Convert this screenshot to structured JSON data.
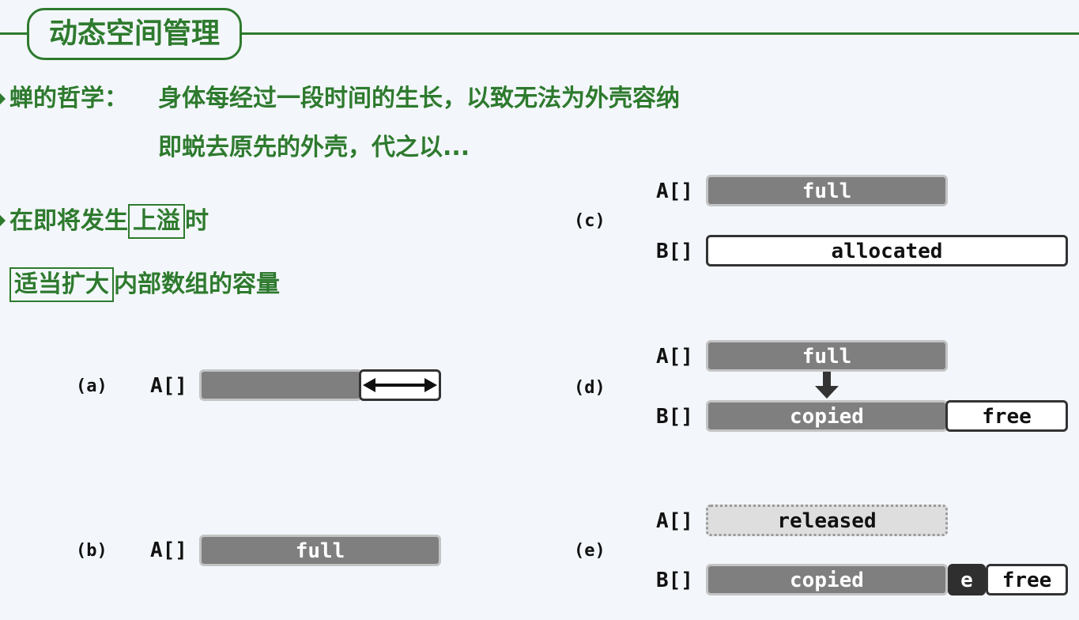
{
  "title": "动态空间管理",
  "lines": {
    "cicada_label": "蝉的哲学：",
    "cicada_line1": "身体每经过一段时间的生长，以致无法为外壳容纳",
    "cicada_line2": "即蜕去原先的外壳，代之以...",
    "overflow_prefix": "在即将发生",
    "overflow_boxed": "上溢",
    "overflow_suffix": "时",
    "expand_boxed": "适当扩大",
    "expand_suffix": "内部数组的容量"
  },
  "panels": {
    "a": {
      "tag": "(a)",
      "arr": "A[]"
    },
    "b": {
      "tag": "(b)",
      "arr": "A[]",
      "bar": "full"
    },
    "c": {
      "tag": "(c)",
      "arr_a": "A[]",
      "bar_a": "full",
      "arr_b": "B[]",
      "bar_b": "allocated"
    },
    "d": {
      "tag": "(d)",
      "arr_a": "A[]",
      "bar_a": "full",
      "arr_b": "B[]",
      "bar_b": "copied",
      "bar_b_free": "free"
    },
    "e": {
      "tag": "(e)",
      "arr_a": "A[]",
      "bar_a": "released",
      "arr_b": "B[]",
      "bar_b": "copied",
      "bar_b_e": "e",
      "bar_b_free": "free"
    }
  },
  "colors": {
    "accent": "#2e7a2e",
    "filled": "#7f7f7f",
    "background": "#f3f7fb"
  }
}
